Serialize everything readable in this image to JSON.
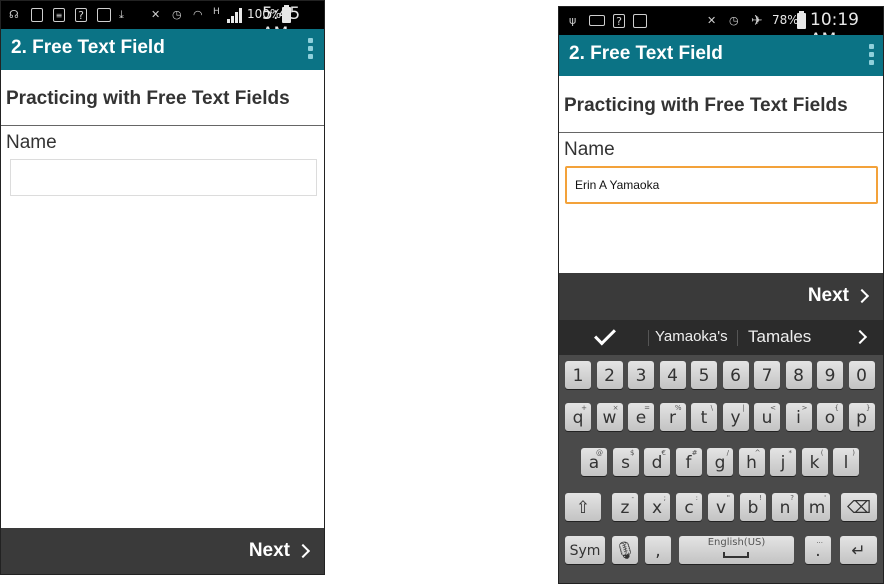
{
  "left_phone": {
    "status": {
      "battery_text": "100%",
      "time": "5:45 AM",
      "network_text": "H"
    },
    "app_title": "2. Free Text Field",
    "section_heading": "Practicing with Free Text Fields",
    "field_label": "Name",
    "name_value": "",
    "next_label": "Next"
  },
  "right_phone": {
    "status": {
      "battery_text": "78%",
      "time": "10:19 AM"
    },
    "app_title": "2. Free Text Field",
    "section_heading": "Practicing with Free Text Fields",
    "field_label": "Name",
    "name_value": "Erin A Yamaoka",
    "next_label": "Next",
    "suggestions": [
      "Yamaoka's",
      "Tamales"
    ],
    "keyboard": {
      "number_row": [
        "1",
        "2",
        "3",
        "4",
        "5",
        "6",
        "7",
        "8",
        "9",
        "0"
      ],
      "row1": [
        {
          "k": "q",
          "s": "+"
        },
        {
          "k": "w",
          "s": "×"
        },
        {
          "k": "e",
          "s": "="
        },
        {
          "k": "r",
          "s": "%"
        },
        {
          "k": "t",
          "s": "\\"
        },
        {
          "k": "y",
          "s": "|"
        },
        {
          "k": "u",
          "s": "<"
        },
        {
          "k": "i",
          "s": ">"
        },
        {
          "k": "o",
          "s": "{"
        },
        {
          "k": "p",
          "s": "}"
        }
      ],
      "row2": [
        {
          "k": "a",
          "s": "@"
        },
        {
          "k": "s",
          "s": "$"
        },
        {
          "k": "d",
          "s": "€"
        },
        {
          "k": "f",
          "s": "#"
        },
        {
          "k": "g",
          "s": "/"
        },
        {
          "k": "h",
          "s": "^"
        },
        {
          "k": "j",
          "s": "*"
        },
        {
          "k": "k",
          "s": "("
        },
        {
          "k": "l",
          "s": ")"
        }
      ],
      "row3": [
        {
          "k": "z",
          "s": "-"
        },
        {
          "k": "x",
          "s": ";"
        },
        {
          "k": "c",
          "s": ":"
        },
        {
          "k": "v",
          "s": "\""
        },
        {
          "k": "b",
          "s": "!"
        },
        {
          "k": "n",
          "s": "?"
        },
        {
          "k": "m",
          "s": "'"
        }
      ],
      "sym_label": "Sym",
      "comma": ",",
      "space_label": "English(US)",
      "period": ".",
      "period_sub": "..."
    }
  },
  "colors": {
    "app_bar": "#0b7385",
    "focus_border": "#f3a23a",
    "next_bar": "#3a3a3a",
    "keyboard_bg": "#4a4a4a"
  },
  "icons": {
    "overflow": "overflow-menu-icon",
    "next": "chevron-right-icon",
    "accept_suggestion": "check-icon",
    "shift": "shift-icon",
    "backspace": "backspace-icon",
    "mic": "mic-icon",
    "enter": "enter-icon"
  }
}
